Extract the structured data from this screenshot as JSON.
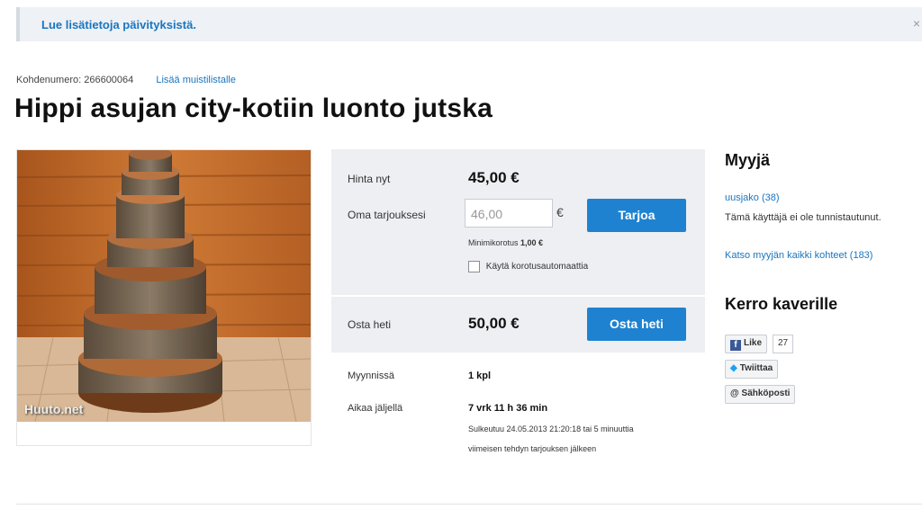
{
  "banner": {
    "link_text": "Lue lisätietoja päivityksistä.",
    "close_icon": "×"
  },
  "meta": {
    "item_number": "Kohdenumero: 266600064",
    "add_to_watchlist": "Lisää muistilistalle"
  },
  "title": "Hippi asujan city-kotiin luonto jutska",
  "photo": {
    "watermark": "Huuto.net"
  },
  "bidding": {
    "price_label": "Hinta nyt",
    "price_value": "45,00 €",
    "your_bid_label": "Oma tarjouksesi",
    "bid_placeholder": "46,00",
    "currency": "€",
    "bid_button": "Tarjoa",
    "min_increase_label": "Minimikorotus",
    "min_increase_value": "1,00 €",
    "auto_increase_label": "Käytä korotusautomaattia",
    "buy_now_label": "Osta heti",
    "buy_now_value": "50,00 €",
    "buy_now_button": "Osta heti"
  },
  "info": {
    "for_sale_label": "Myynnissä",
    "for_sale_value": "1 kpl",
    "time_left_label": "Aikaa jäljellä",
    "time_left_value": "7 vrk 11 h 36 min",
    "closing_line1": "Sulkeutuu 24.05.2013 21:20:18 tai 5 minuuttia",
    "closing_line2": "viimeisen tehdyn tarjouksen jälkeen"
  },
  "seller": {
    "heading": "Myyjä",
    "name": "uusjako (38)",
    "status": "Tämä käyttäjä ei ole tunnistautunut.",
    "all_items_link": "Katso myyjän kaikki kohteet (183)"
  },
  "share": {
    "heading": "Kerro kaverille",
    "like_label": "Like",
    "like_count": "27",
    "tweet_label": "Twiittaa",
    "email_label": "@ Sähköposti"
  },
  "icons": {
    "facebook": "facebook-icon",
    "twitter": "twitter-icon",
    "close": "close-icon"
  },
  "colors": {
    "accent": "#1e82d0",
    "link": "#1976c0",
    "panel": "#edeff2"
  }
}
